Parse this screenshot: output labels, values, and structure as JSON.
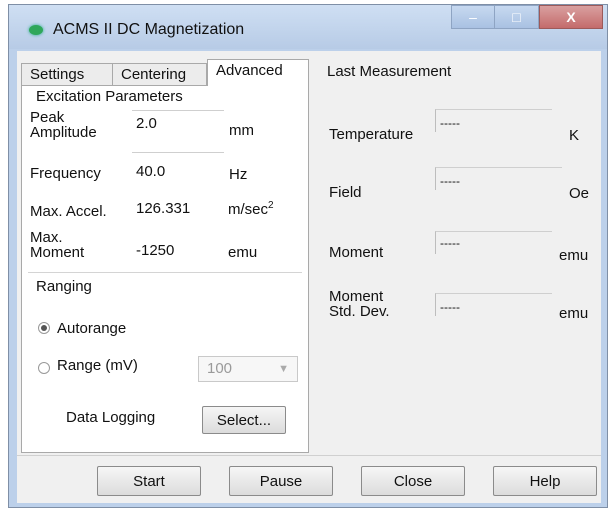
{
  "window": {
    "title": "ACMS II DC Magnetization"
  },
  "title_buttons": {
    "minimize": "–",
    "maximize": "□",
    "close": "X"
  },
  "tabs": [
    "Settings",
    "Centering",
    "Advanced"
  ],
  "excitation": {
    "title": "Excitation Parameters",
    "peak_amplitude_label": "Peak\nAmplitude",
    "peak_amplitude_value": "2.0",
    "peak_amplitude_unit": "mm",
    "frequency_label": "Frequency",
    "frequency_value": "40.0",
    "frequency_unit": "Hz",
    "max_accel_label": "Max. Accel.",
    "max_accel_value": "126.331",
    "max_accel_unit": "m/sec",
    "max_accel_unit_sup": "2",
    "max_moment_label": "Max.\nMoment",
    "max_moment_value": "-1250",
    "max_moment_unit": "emu"
  },
  "ranging": {
    "title": "Ranging",
    "autorange_label": "Autorange",
    "range_label": "Range (mV)",
    "range_value": "100"
  },
  "logging": {
    "label": "Data Logging",
    "select_button": "Select..."
  },
  "last_measurement": {
    "title": "Last Measurement",
    "temperature_label": "Temperature",
    "temperature_value": "-----",
    "temperature_unit": "K",
    "field_label": "Field",
    "field_value": "-----",
    "field_unit": "Oe",
    "moment_label": "Moment",
    "moment_value": "-----",
    "moment_unit": "emu",
    "moment_std_label": "Moment\nStd. Dev.",
    "moment_std_value": "-----",
    "moment_std_unit": "emu"
  },
  "buttons": {
    "start": "Start",
    "pause": "Pause",
    "close": "Close",
    "help": "Help"
  }
}
